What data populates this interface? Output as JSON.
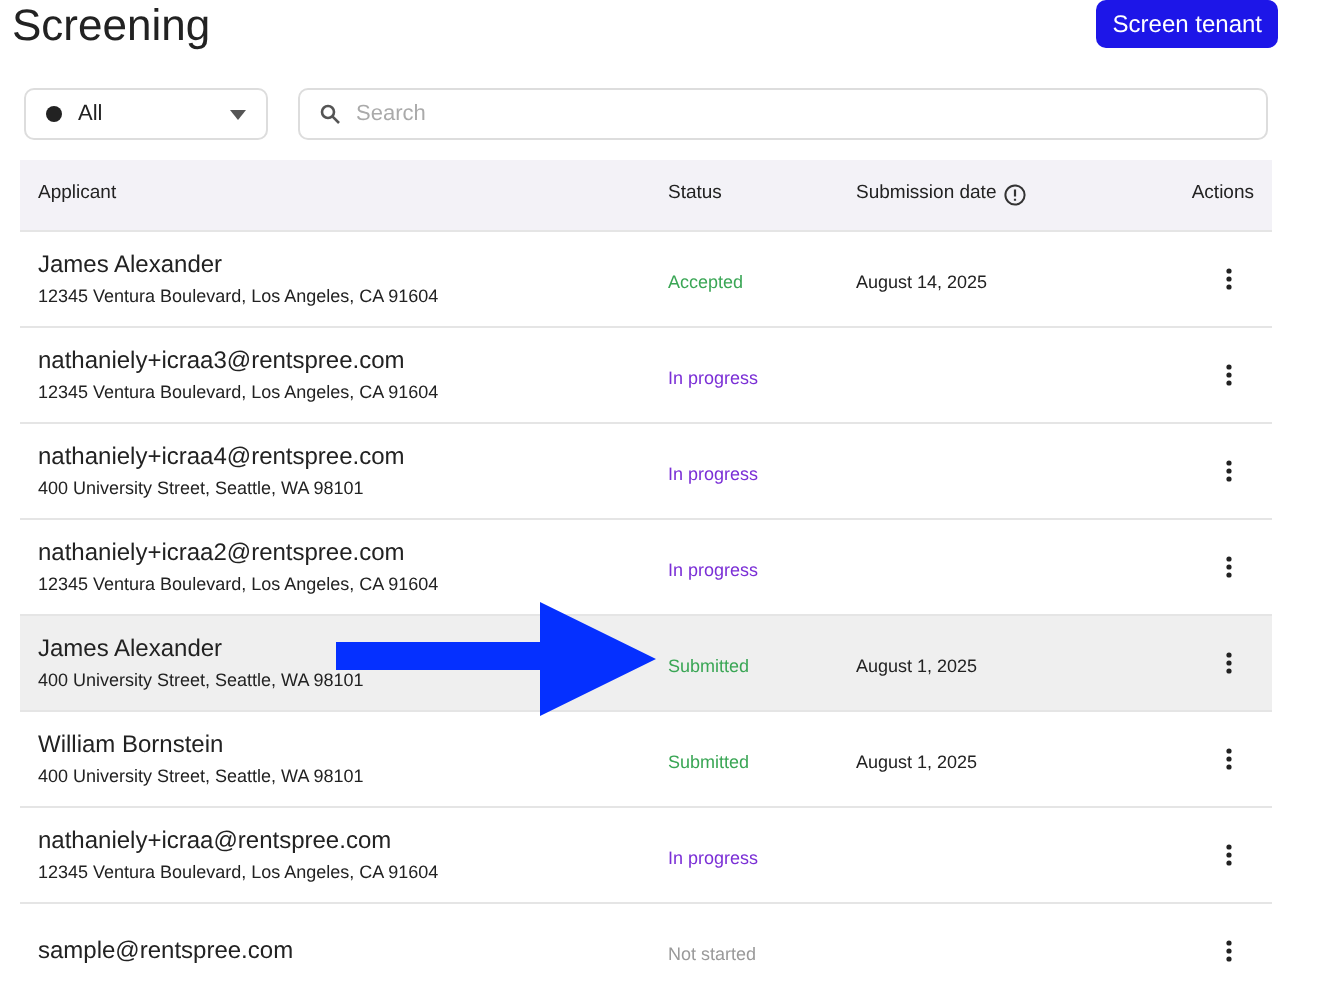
{
  "page": {
    "title": "Screening",
    "action_button": "Screen tenant"
  },
  "filters": {
    "status": {
      "value": "All"
    },
    "search": {
      "placeholder": "Search"
    }
  },
  "table": {
    "columns": [
      "Applicant",
      "Status",
      "Submission date",
      "Actions"
    ],
    "rows": [
      {
        "name": "James Alexander",
        "address": "12345 Ventura Boulevard, Los Angeles, CA 91604",
        "status": "Accepted",
        "color": "#3aa655",
        "date": "August 14, 2025",
        "selected": false
      },
      {
        "name": "nathaniely+icraa3@rentspree.com",
        "address": "12345 Ventura Boulevard, Los Angeles, CA 91604",
        "status": "In progress",
        "color": "#7b2fd6",
        "date": "",
        "selected": false
      },
      {
        "name": "nathaniely+icraa4@rentspree.com",
        "address": "400 University Street, Seattle, WA 98101",
        "status": "In progress",
        "color": "#7b2fd6",
        "date": "",
        "selected": false
      },
      {
        "name": "nathaniely+icraa2@rentspree.com",
        "address": "12345 Ventura Boulevard, Los Angeles, CA 91604",
        "status": "In progress",
        "color": "#7b2fd6",
        "date": "",
        "selected": false
      },
      {
        "name": "James Alexander",
        "address": "400 University Street, Seattle, WA 98101",
        "status": "Submitted",
        "color": "#3aa655",
        "date": "August 1, 2025",
        "selected": true
      },
      {
        "name": "William Bornstein",
        "address": "400 University Street, Seattle, WA 98101",
        "status": "Submitted",
        "color": "#3aa655",
        "date": "August 1, 2025",
        "selected": false
      },
      {
        "name": "nathaniely+icraa@rentspree.com",
        "address": "12345 Ventura Boulevard, Los Angeles, CA 91604",
        "status": "In progress",
        "color": "#7b2fd6",
        "date": "",
        "selected": false
      },
      {
        "name": "sample@rentspree.com",
        "address": "",
        "status": "Not started",
        "color": "#9a9a9a",
        "date": "",
        "selected": false
      }
    ]
  }
}
